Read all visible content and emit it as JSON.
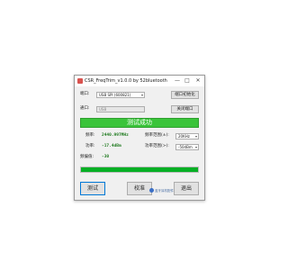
{
  "window": {
    "title": "CSR_FreqTrim_v1.0.0 by 52bluetooth",
    "icon": "app-icon",
    "controls": {
      "minimize": "—",
      "maximize": "□",
      "close": "✕"
    }
  },
  "port": {
    "label": "端口:",
    "value": "USB SPI (600821)",
    "init_button": "端口初始化"
  },
  "channel": {
    "label": "通口:",
    "value": "USB",
    "close_button": "关闭端口"
  },
  "status": {
    "text": "测试成功",
    "color": "#3ac43a"
  },
  "freq": {
    "label": "频率:",
    "value": "2440.997MHz",
    "range_label": "频率范围(±):",
    "range_value": "20KHz"
  },
  "power": {
    "label": "功率:",
    "value": "-17.4dBm",
    "range_label": "功率范围(>):",
    "range_value": "-50dBm"
  },
  "offset": {
    "label": "频偏值:",
    "value": "-30"
  },
  "progress": {
    "fraction": 1.0
  },
  "buttons": {
    "test": "测试",
    "calibrate": "校准",
    "exit": "退出"
  },
  "brand": {
    "text": "蓝牙耳机配件"
  }
}
